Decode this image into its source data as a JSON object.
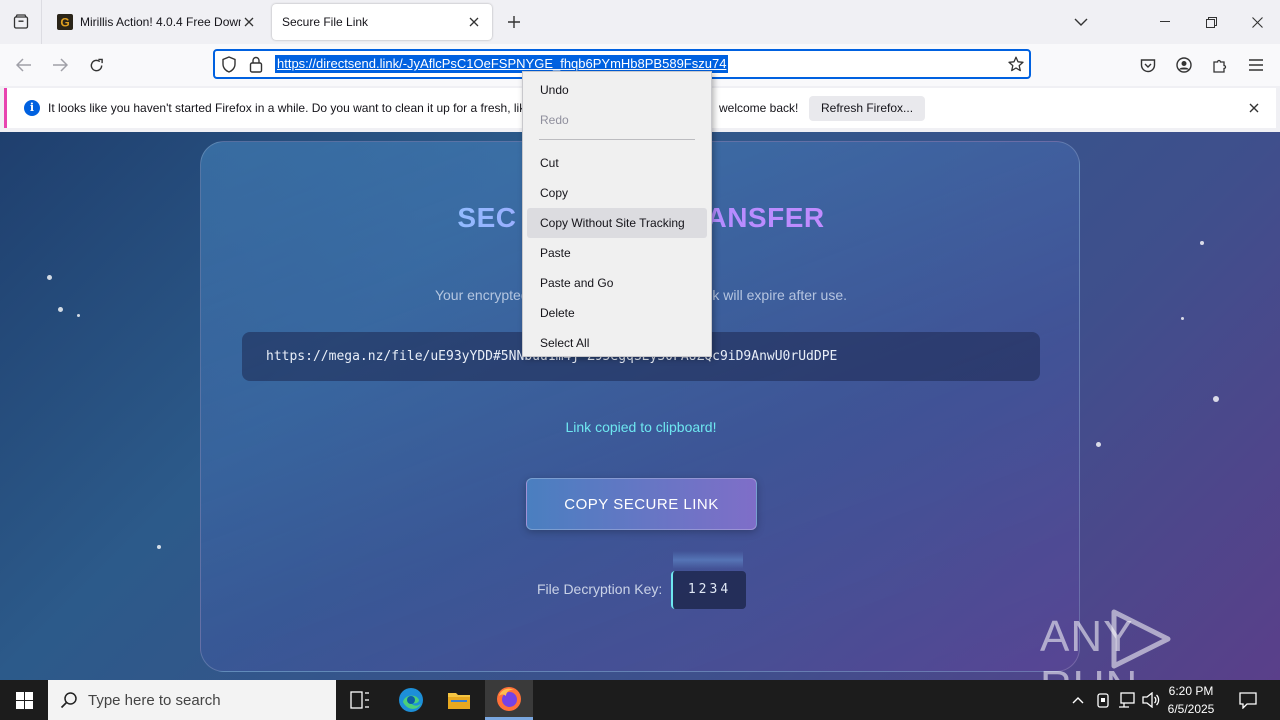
{
  "tabs": [
    {
      "title": "Mirillis Action! 4.0.4 Free Downl",
      "favicon": "mirillis-g-icon"
    },
    {
      "title": "Secure File Link",
      "active": true
    }
  ],
  "navbar": {
    "url": "https://directsend.link/-JyAflcPsC1OeFSPNYGE_fhqb6PYmHb8PB589Fszu74"
  },
  "notification": {
    "message": "It looks like you haven't started Firefox in a while. Do you want to clean it up for a fresh, like",
    "message_tail": "welcome back!",
    "button": "Refresh Firefox..."
  },
  "page": {
    "headline_left": "SEC",
    "headline_right": "ANSFER",
    "subtitle_left": "Your encrypted",
    "subtitle_right": "nk will expire after use.",
    "link": "https://mega.nz/file/uE93yYDD#5NNbuu1m4j-Z95egqSEy30FAUZQc9iD9AnwU0rUdDPE",
    "copied_msg": "Link copied to clipboard!",
    "copy_button": "COPY SECURE LINK",
    "key_label": "File Decryption Key:",
    "key_value": "1234"
  },
  "context_menu": {
    "items": [
      {
        "label": "Undo",
        "disabled": false
      },
      {
        "label": "Redo",
        "disabled": true
      },
      {
        "label": "Cut",
        "disabled": false
      },
      {
        "label": "Copy",
        "disabled": false
      },
      {
        "label": "Copy Without Site Tracking",
        "disabled": false,
        "hover": true
      },
      {
        "label": "Paste",
        "disabled": false
      },
      {
        "label": "Paste and Go",
        "disabled": false
      },
      {
        "label": "Delete",
        "disabled": false
      },
      {
        "label": "Select All",
        "disabled": false
      }
    ]
  },
  "watermark": {
    "text_left": "ANY",
    "text_right": "RUN"
  },
  "taskbar": {
    "search_placeholder": "Type here to search",
    "time": "6:20 PM",
    "date": "6/5/2025"
  },
  "colors": {
    "accent": "#0061e0",
    "notif_bar": "#e844b0",
    "copied_text": "#6ee7f0"
  }
}
